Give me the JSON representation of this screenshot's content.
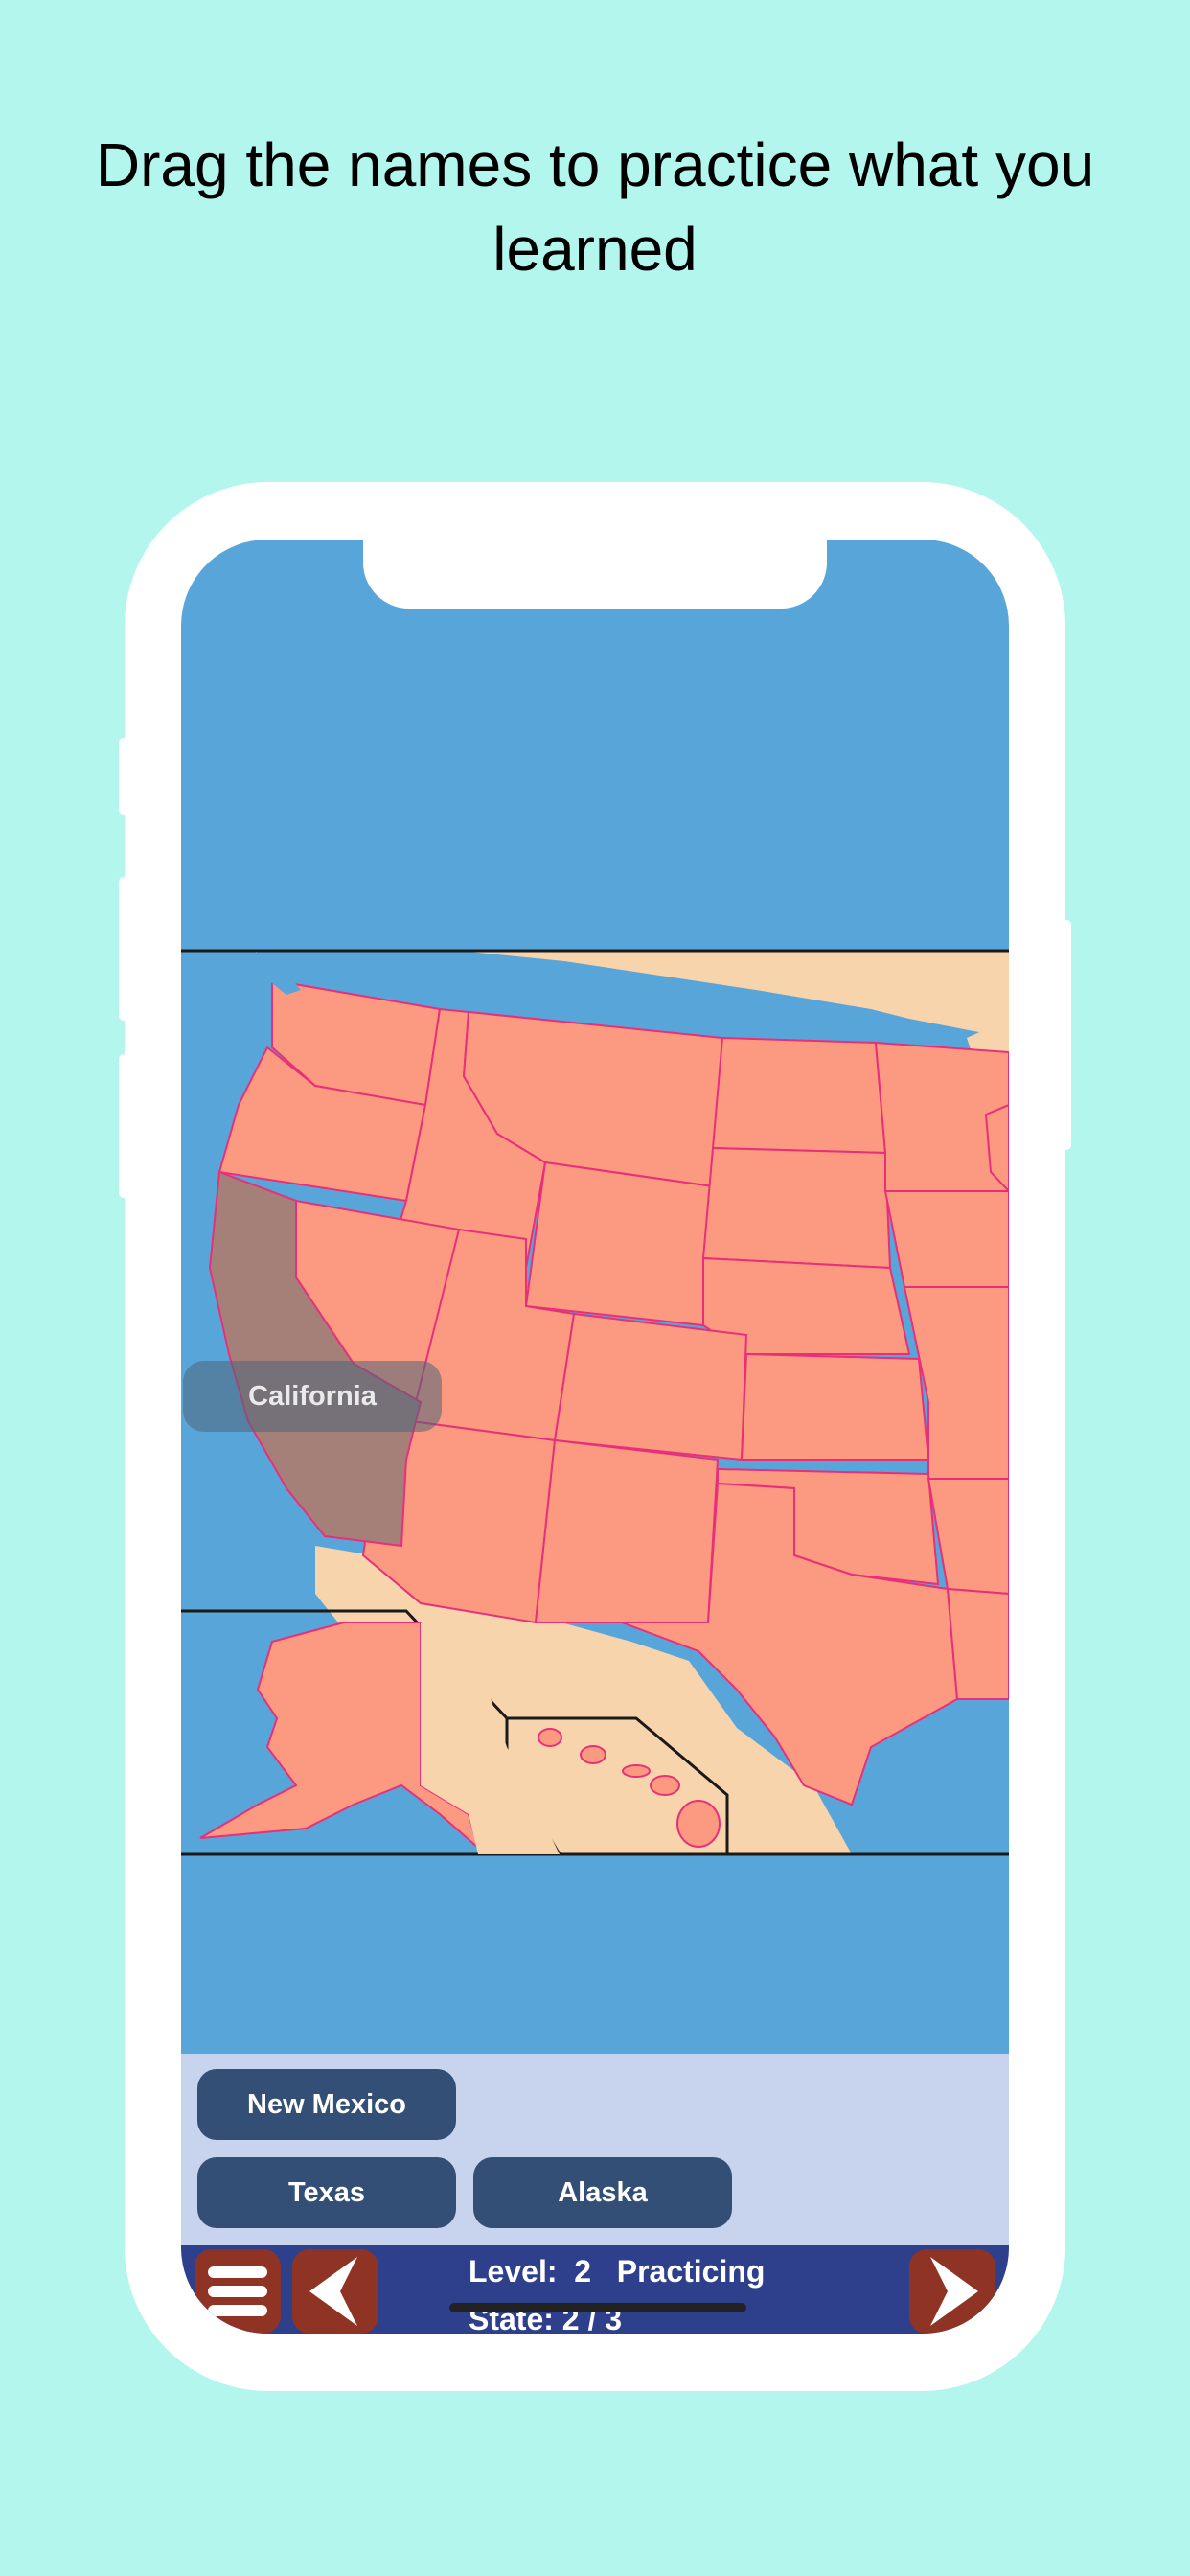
{
  "headline": "Drag the names to practice what you learned",
  "map": {
    "dragged_label": "California"
  },
  "name_tray": {
    "chips": [
      "New Mexico",
      "Texas",
      "Alaska"
    ]
  },
  "status_bar": {
    "level_text": "Level:  2   Practicing",
    "state_text": "State: 2 / 3"
  },
  "icons": {
    "menu": "hamburger-menu-icon",
    "back": "arrow-left-icon",
    "forward": "arrow-right-icon"
  },
  "colors": {
    "background": "#b3f6ee",
    "ocean": "#58a6d9",
    "land_unselected": "#f8d4ad",
    "state_fill": "#fb9a80",
    "state_border": "#e8307a",
    "selected_state": "#a58078",
    "chip": "#334f75",
    "tray": "#c8d3ee",
    "bottom_bar": "#2e3f8c",
    "bar_button": "#8f3324"
  }
}
